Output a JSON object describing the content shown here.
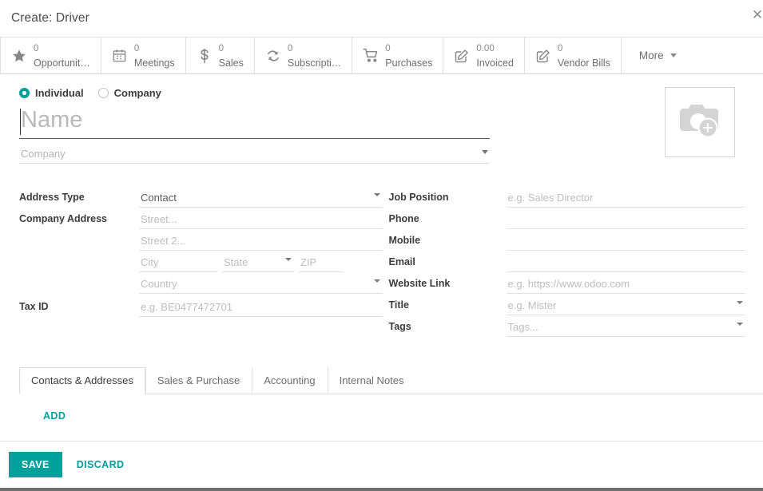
{
  "dialog": {
    "title": "Create: Driver",
    "close_label": "✕"
  },
  "stat_buttons": [
    {
      "value": "0",
      "label": "Opportunit…",
      "icon": "star-icon"
    },
    {
      "value": "0",
      "label": "Meetings",
      "icon": "calendar-icon"
    },
    {
      "value": "0",
      "label": "Sales",
      "icon": "dollar-icon"
    },
    {
      "value": "0",
      "label": "Subscripti…",
      "icon": "refresh-icon"
    },
    {
      "value": "0",
      "label": "Purchases",
      "icon": "cart-icon"
    },
    {
      "value": "0.00",
      "label": "Invoiced",
      "icon": "pencil-square-icon"
    },
    {
      "value": "0",
      "label": "Vendor Bills",
      "icon": "pencil-square-icon"
    }
  ],
  "more_button": {
    "label": "More"
  },
  "contact_type": {
    "individual_label": "Individual",
    "company_label": "Company",
    "selected": "Individual"
  },
  "identity": {
    "name_value": "",
    "name_placeholder": "Name",
    "company_value": "",
    "company_placeholder": "Company"
  },
  "avatar": {
    "icon": "camera-add-icon"
  },
  "left_fields": {
    "address_type_label": "Address Type",
    "address_type_value": "Contact",
    "company_address_label": "Company Address",
    "street_placeholder": "Street...",
    "street2_placeholder": "Street 2...",
    "city_placeholder": "City",
    "state_placeholder": "State",
    "zip_placeholder": "ZIP",
    "country_placeholder": "Country",
    "tax_id_label": "Tax ID",
    "tax_id_placeholder": "e.g. BE0477472701"
  },
  "right_fields": [
    {
      "label": "Job Position",
      "value": "",
      "placeholder": "e.g. Sales Director",
      "dropdown": false
    },
    {
      "label": "Phone",
      "value": "",
      "placeholder": "",
      "dropdown": false
    },
    {
      "label": "Mobile",
      "value": "",
      "placeholder": "",
      "dropdown": false
    },
    {
      "label": "Email",
      "value": "",
      "placeholder": "",
      "dropdown": false
    },
    {
      "label": "Website Link",
      "value": "",
      "placeholder": "e.g. https://www.odoo.com",
      "dropdown": false
    },
    {
      "label": "Title",
      "value": "",
      "placeholder": "e.g. Mister",
      "dropdown": true
    },
    {
      "label": "Tags",
      "value": "",
      "placeholder": "Tags...",
      "dropdown": true
    }
  ],
  "tabs": [
    {
      "label": "Contacts & Addresses",
      "active": true
    },
    {
      "label": "Sales & Purchase",
      "active": false
    },
    {
      "label": "Accounting",
      "active": false
    },
    {
      "label": "Internal Notes",
      "active": false
    }
  ],
  "tab_body": {
    "add_label": "ADD"
  },
  "footer": {
    "save_label": "SAVE",
    "discard_label": "DISCARD"
  },
  "colors": {
    "accent": "#00a09d",
    "text": "#4c4c4c",
    "muted": "#bdbdbd",
    "border": "#e0e0e0"
  }
}
